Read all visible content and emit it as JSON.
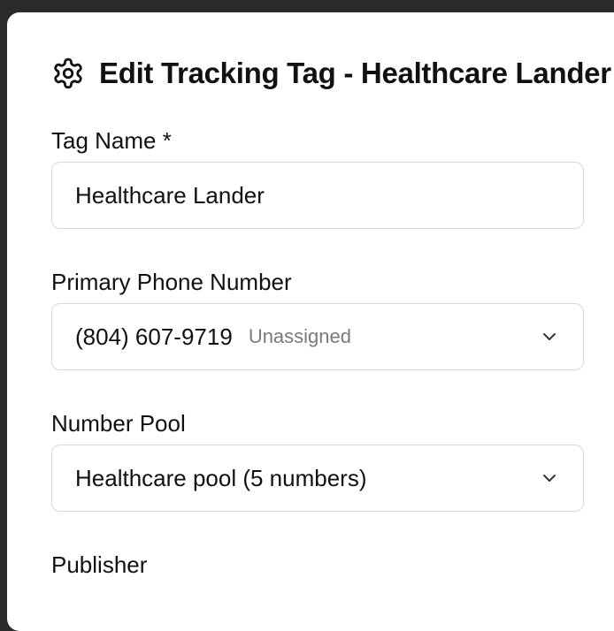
{
  "modal": {
    "title": "Edit Tracking Tag - Healthcare Lander",
    "icon": "gear-icon"
  },
  "form": {
    "tag_name": {
      "label": "Tag Name *",
      "value": "Healthcare Lander"
    },
    "primary_phone": {
      "label": "Primary Phone Number",
      "number": "(804) 607-9719",
      "status": "Unassigned"
    },
    "number_pool": {
      "label": "Number Pool",
      "value": "Healthcare pool (5 numbers)"
    },
    "publisher": {
      "label": "Publisher"
    }
  },
  "colors": {
    "border": "#d9d9d9",
    "muted_text": "#7a7a7a",
    "text": "#111111"
  }
}
